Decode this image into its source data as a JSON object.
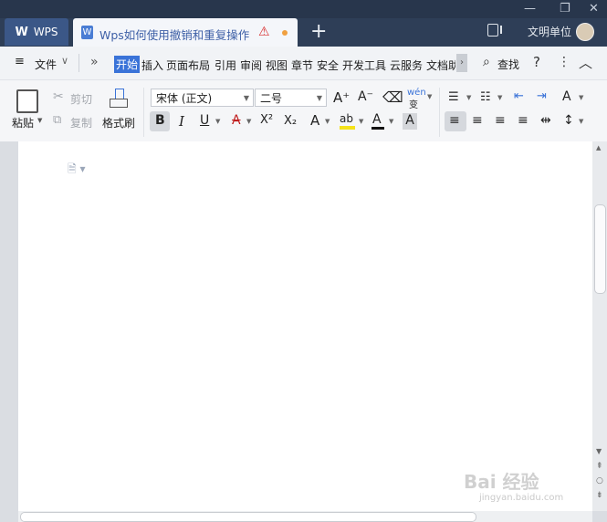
{
  "titlebar": {
    "app_tab_label": "WPS",
    "doc_tab_title": "Wps如何使用撤销和重复操作",
    "new_tab_symbol": "+",
    "user_label": "文明单位",
    "window_controls": {
      "minimize": "—",
      "restore": "❐",
      "close": "✕"
    }
  },
  "menubar": {
    "file_label": "文件",
    "more_symbol": "»",
    "tabs": [
      "开始",
      "插入",
      "页面布局",
      "引用",
      "审阅",
      "视图",
      "章节",
      "安全",
      "开发工具",
      "云服务",
      "文档助"
    ],
    "active_tab": "开始",
    "search_label": "查找",
    "help_symbol": "?",
    "more_menu_symbol": "⋮",
    "collapse_symbol": "︿"
  },
  "ribbon": {
    "paste_label": "粘贴",
    "cut_label": "剪切",
    "copy_label": "复制",
    "format_painter_label": "格式刷",
    "font_name": "宋体 (正文)",
    "font_size": "二号",
    "bold": "B",
    "italic": "I",
    "underline": "U",
    "strikethrough": "A",
    "superscript": "X²",
    "subscript": "X₂",
    "font_effect": "A",
    "highlight": "ab",
    "font_color": "A",
    "char_shading": "A",
    "grow_font": "A⁺",
    "shrink_font": "A⁻",
    "phonetic": "wén"
  },
  "watermark": {
    "text": "Bai 经验",
    "sub": "jingyan.baidu.com"
  },
  "colors": {
    "titlebar_bg": "#2e3e57",
    "accent": "#3a73d8",
    "wps_tab_bg": "#3b5787"
  }
}
